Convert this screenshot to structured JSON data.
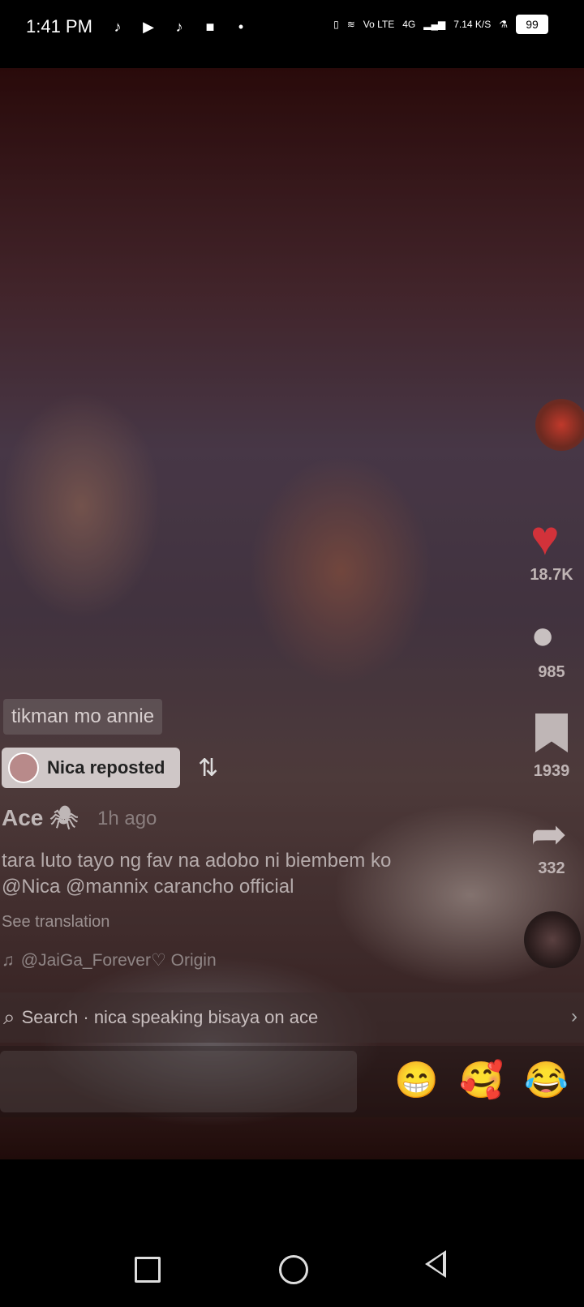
{
  "status_bar": {
    "time": "1:41 PM",
    "left_icons": [
      "tiktok-icon",
      "youtube-icon",
      "tiktok-icon",
      "video-camera-icon",
      "dot-icon"
    ],
    "network": "4G",
    "volte": "Vo LTE",
    "speed": "7.14 K/S",
    "battery": "99"
  },
  "video": {
    "caption_chip": "tikman mo annie",
    "repost_label": "Nica reposted",
    "username": "Ace 🕷",
    "time_ago": "1h ago",
    "description": "tara luto tayo ng fav na adobo ni biembem ko @Nica @mannix carancho official",
    "see_translation": "See translation",
    "music": "@JaiGa_Forever♡ Origin"
  },
  "search": {
    "text": "Search · nica speaking bisaya on ace"
  },
  "emojis": [
    "😁",
    "🥰",
    "😂"
  ],
  "rail": {
    "likes": "18.7K",
    "comments": "985",
    "saves": "1939",
    "shares": "332"
  },
  "colors": {
    "like": "#d2323a"
  }
}
